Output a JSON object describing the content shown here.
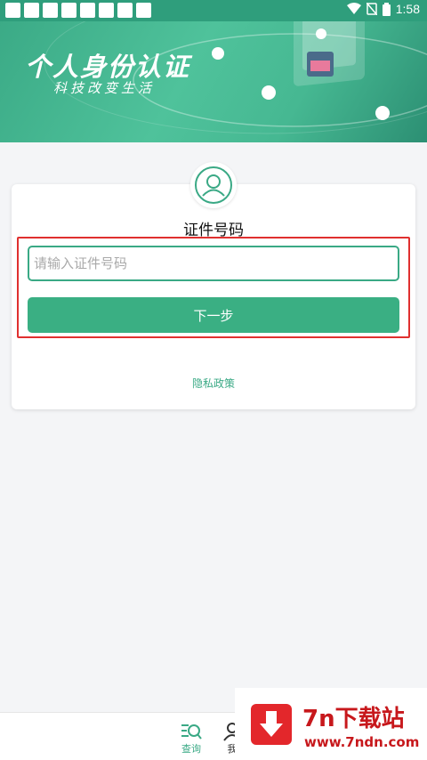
{
  "status_bar": {
    "time": "1:58"
  },
  "banner": {
    "title": "个人身份认证",
    "subtitle": "科技改变生活"
  },
  "form": {
    "title": "证件号码",
    "id_placeholder": "请输入证件号码",
    "next_label": "下一步",
    "privacy_label": "隐私政策"
  },
  "bottom_nav": {
    "items": [
      {
        "label": "查询"
      },
      {
        "label": "我"
      }
    ]
  },
  "watermark": {
    "title": "7n下载站",
    "url": "www.7ndn.com"
  },
  "colors": {
    "brand": "#3aa985",
    "button": "#3aaf83",
    "highlight": "#e0302f",
    "watermark": "#c7181c"
  }
}
